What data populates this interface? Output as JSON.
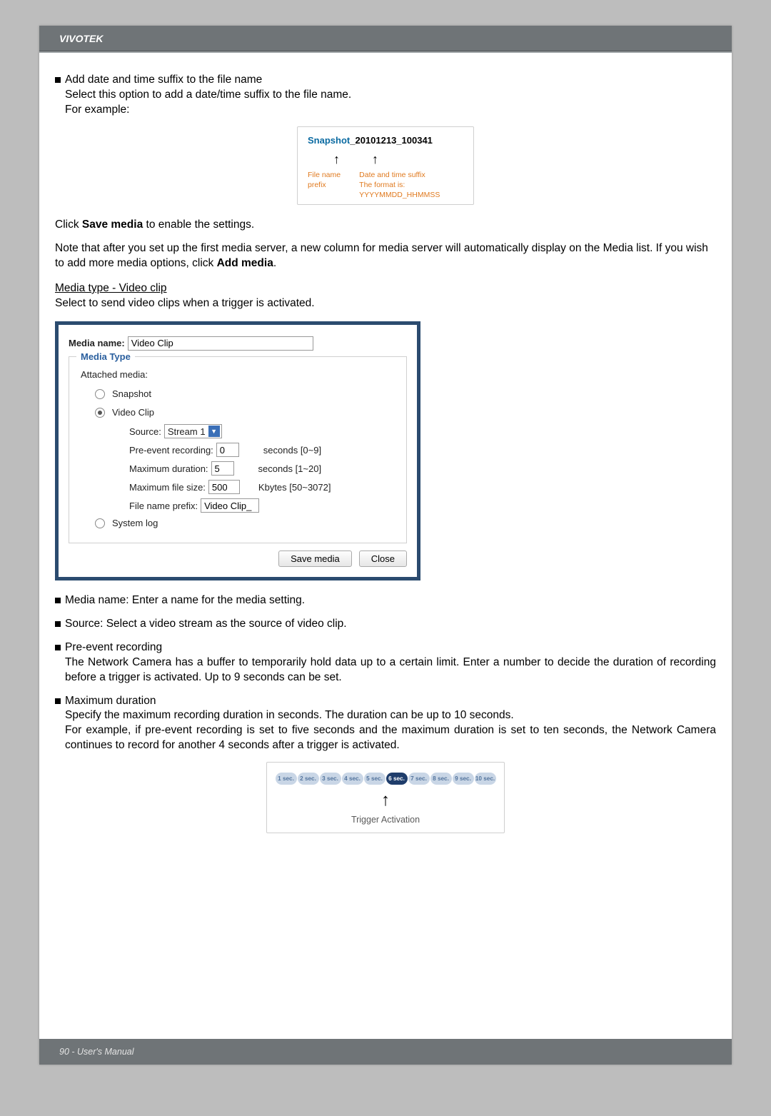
{
  "header": {
    "brand": "VIVOTEK"
  },
  "section_suffix": {
    "title": "Add date and time suffix to the file name",
    "line1": "Select this option to add a date/time suffix to the file name.",
    "line2": "For example:",
    "example": {
      "prefix": "Snapshot",
      "suffix": "_20101213_100341",
      "label_prefix": "File name prefix",
      "label_suffix": "Date and time suffix",
      "label_format": "The format is: YYYYMMDD_HHMMSS"
    }
  },
  "click_save": {
    "pre": "Click ",
    "bold": "Save media",
    "post": " to enable the settings."
  },
  "note_paragraph": {
    "part1": "Note that after you set up the first media server, a new column for media server will automatically display on the Media list.  If you wish to add more media options, click ",
    "bold": "Add media",
    "part2": "."
  },
  "media_type_heading": "Media type - Video clip",
  "media_type_line": "Select to send video clips when a trigger is activated.",
  "form": {
    "media_name_label": "Media name:",
    "media_name_value": "Video Clip",
    "fieldset_title": "Media Type",
    "attached_media": "Attached media:",
    "opt_snapshot": "Snapshot",
    "opt_videoclip": "Video Clip",
    "source_label": "Source:",
    "source_value": "Stream 1",
    "pre_event_label": "Pre-event recording:",
    "pre_event_value": "0",
    "pre_event_hint": "seconds [0~9]",
    "max_dur_label": "Maximum duration:",
    "max_dur_value": "5",
    "max_dur_hint": "seconds [1~20]",
    "max_size_label": "Maximum file size:",
    "max_size_value": "500",
    "max_size_hint": "Kbytes [50~3072]",
    "prefix_label": "File name prefix:",
    "prefix_value": "Video Clip_",
    "opt_systemlog": "System log",
    "btn_save": "Save media",
    "btn_close": "Close"
  },
  "bullets": {
    "media_name": "Media name: Enter a name for the media setting.",
    "source": "Source: Select a video stream as the source of video clip.",
    "pre_event_title": "Pre-event recording",
    "pre_event_body": "The Network Camera has a buffer to temporarily hold data up to a certain limit. Enter a number to decide the duration of recording before a trigger is activated. Up to 9 seconds can be set.",
    "max_dur_title": "Maximum duration",
    "max_dur_body1": "Specify the maximum recording duration in seconds. The duration can be up to 10 seconds.",
    "max_dur_body2": "For example, if pre-event recording is set to five seconds and the maximum duration is set to ten seconds, the Network Camera continues to record for another 4 seconds after a trigger is activated."
  },
  "timeline": {
    "items": [
      "1 sec.",
      "2 sec.",
      "3 sec.",
      "4 sec.",
      "5 sec.",
      "6 sec.",
      "7 sec.",
      "8 sec.",
      "9 sec.",
      "10 sec."
    ],
    "active_index": 5,
    "label": "Trigger Activation"
  },
  "footer": {
    "text": "90 - User's Manual"
  }
}
